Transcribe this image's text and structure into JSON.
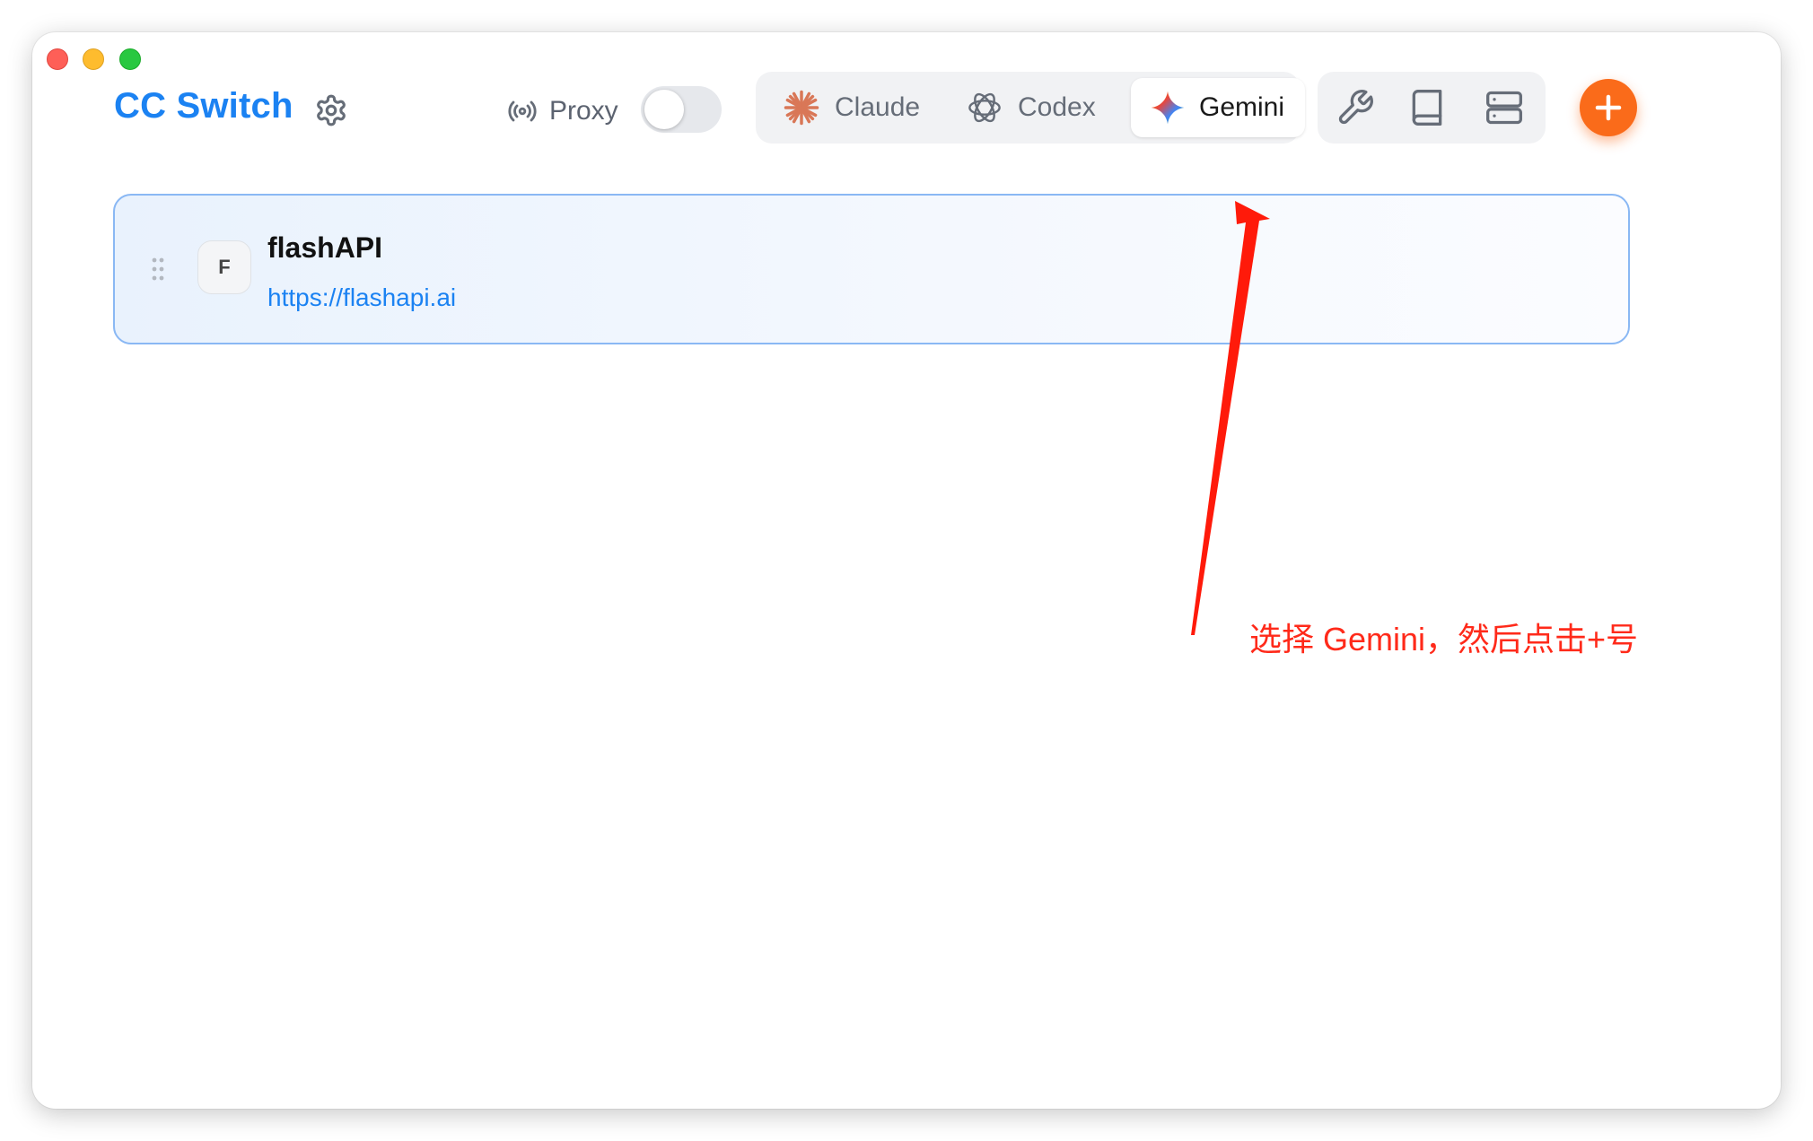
{
  "window": {
    "traffic_lights": [
      "close",
      "minimize",
      "maximize"
    ]
  },
  "header": {
    "app_title": "CC Switch",
    "settings_icon": "gear-icon",
    "proxy": {
      "icon": "broadcast-icon",
      "label": "Proxy",
      "enabled": false
    }
  },
  "app_tabs": {
    "active": "Gemini",
    "items": [
      {
        "label": "Claude",
        "icon": "claude-starburst-icon",
        "color": "#d97757"
      },
      {
        "label": "Codex",
        "icon": "openai-knot-icon",
        "color": "#666d78"
      },
      {
        "label": "Gemini",
        "icon": "gemini-sparkle-icon",
        "color": "#4285f4"
      }
    ]
  },
  "tools": [
    {
      "icon": "wrench-icon"
    },
    {
      "icon": "book-icon"
    },
    {
      "icon": "server-icon"
    }
  ],
  "add_button": {
    "icon": "plus-icon",
    "color": "#fa6b1a"
  },
  "providers": [
    {
      "avatar_letter": "F",
      "name": "flashAPI",
      "url": "https://flashapi.ai",
      "selected": true
    }
  ],
  "annotation": {
    "text": "选择 Gemini，然后点击+号",
    "color": "#ff2a1a"
  }
}
